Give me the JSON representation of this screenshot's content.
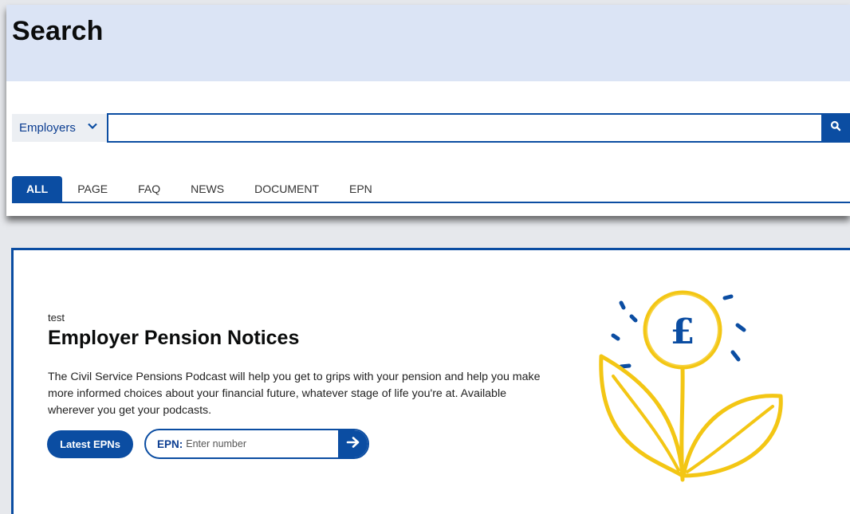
{
  "search": {
    "title": "Search",
    "scope_selected": "Employers",
    "input_value": "",
    "tabs": [
      "ALL",
      "PAGE",
      "FAQ",
      "NEWS",
      "DOCUMENT",
      "EPN"
    ],
    "active_tab": "ALL"
  },
  "epn": {
    "eyebrow": "test",
    "title": "Employer Pension Notices",
    "description": "The Civil Service Pensions Podcast will help you get to grips with your pension and help you make more informed choices about your financial future, whatever stage of life you're at. Available wherever you get your podcasts.",
    "latest_button": "Latest EPNs",
    "field_label": "EPN:",
    "field_placeholder": "Enter number",
    "illustration_symbol": "£"
  },
  "colors": {
    "primary": "#0b4da2",
    "header_bg": "#dbe4f5",
    "illustration_yellow": "#f3c614"
  },
  "icons": [
    "chevron-down-icon",
    "search-icon",
    "arrow-right-icon",
    "coin-plant-illustration"
  ]
}
